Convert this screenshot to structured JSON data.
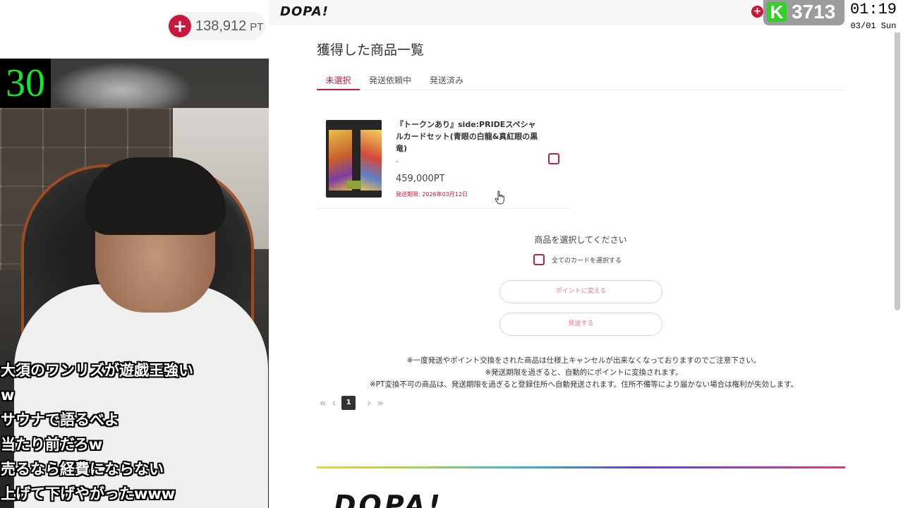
{
  "stream": {
    "points_value": "138,912",
    "points_unit": "PT",
    "timer": "30",
    "comments": [
      "大須のワンリズが遊戯王強い",
      "w",
      "サウナで語るべよ",
      "当たり前だろw",
      "売るなら経費にならない",
      "上げて下げやがったwww"
    ]
  },
  "overlay": {
    "kick_letter": "K",
    "kick_count": "3713",
    "clock_time": "01:19",
    "clock_date": "03/01 Sun"
  },
  "site": {
    "logo": "DOPA!",
    "page_title": "獲得した商品一覧",
    "tabs": [
      "未選択",
      "発送依頼中",
      "発送済み"
    ],
    "active_tab": 0,
    "item": {
      "title": "『トークンあり』side:PRIDEスペシャルカードセット(青眼の白龍&真紅眼の黒竜)",
      "dash": "-",
      "price": "459,000PT",
      "deadline": "発送期限: 2026年03月12日"
    },
    "select_prompt": "商品を選択してください",
    "select_all_label": "全てのカードを選択する",
    "convert_button": "ポイントに変える",
    "ship_button": "発送する",
    "notes": [
      "※一度発送やポイント交換をされた商品は仕様上キャンセルが出来なくなっておりますのでご注意下さい。",
      "※発送期限を過ぎると、自動的にポイントに変換されます。",
      "※PT変換不可の商品は、発送期限を過ぎると登録住所へ自動発送されます。住所不備等により届かない場合は権利が失効します。"
    ],
    "pager": {
      "first": "«",
      "prev": "‹",
      "current": "1",
      "next": "›",
      "last": "»"
    },
    "footer_logo": "DOPA!"
  },
  "colors": {
    "accent": "#c8193c",
    "kick_green": "#31d12a",
    "timer_green": "#10e82a"
  }
}
